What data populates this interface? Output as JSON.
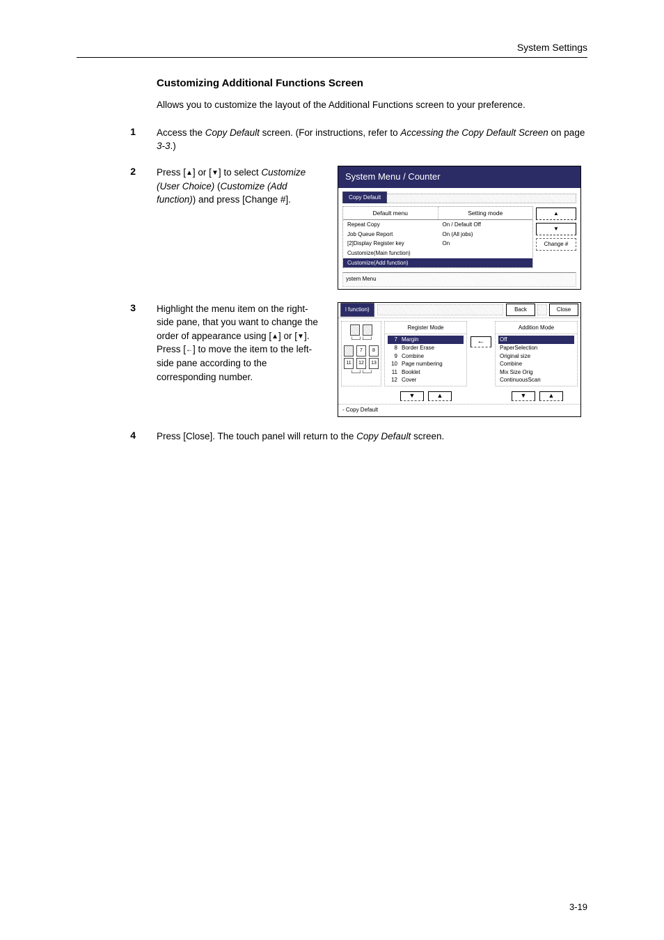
{
  "header": {
    "section": "System Settings"
  },
  "title": "Customizing Additional Functions Screen",
  "intro": "Allows you to customize the layout of the Additional Functions screen to your preference.",
  "steps": {
    "s1": {
      "num": "1",
      "a": "Access the ",
      "b": "Copy Default",
      "c": " screen. (For instructions, refer to ",
      "d": "Accessing the Copy Default Screen",
      "e": " on page ",
      "f": "3-3",
      "g": ".)"
    },
    "s2": {
      "num": "2",
      "a": "Press [",
      "b": "] or [",
      "c": "] to select ",
      "d": "Customize (User Choice)",
      "e": " (",
      "f": "Customize (Add function)",
      "g": ") and press [Change #]."
    },
    "s3": {
      "num": "3",
      "a": "Highlight the menu item on the right-side pane, that you want to change the order of appearance using [",
      "b": "] or [",
      "c": "]. Press [",
      "d": "] to move the item to the left-side pane according to the corresponding number."
    },
    "s4": {
      "num": "4",
      "a": "Press [Close]. The touch panel will return to the ",
      "b": "Copy Default",
      "c": " screen."
    }
  },
  "panel1": {
    "title": "System Menu / Counter",
    "tab": "Copy Default",
    "th1": "Default menu",
    "th2": "Setting mode",
    "rows": [
      {
        "c1": "Repeat Copy",
        "c2": "On / Default Off"
      },
      {
        "c1": "Job Queue Report",
        "c2": "On (All jobs)"
      },
      {
        "c1": "[2]Display Register key",
        "c2": "On"
      },
      {
        "c1": "Customize(Main function)",
        "c2": ""
      },
      {
        "c1": "Customize(Add function)",
        "c2": ""
      }
    ],
    "btn_change": "Change #",
    "footer": "ystem Menu"
  },
  "panel2": {
    "tab": "l function)",
    "back": "Back",
    "close": "Close",
    "reg_h": "Register Mode",
    "add_h": "Addition Mode",
    "reg_items": [
      {
        "n": "7",
        "t": "Margin"
      },
      {
        "n": "8",
        "t": "Border Erase"
      },
      {
        "n": "9",
        "t": "Combine"
      },
      {
        "n": "10",
        "t": "Page numbering"
      },
      {
        "n": "11",
        "t": "Booklet"
      },
      {
        "n": "12",
        "t": "Cover"
      }
    ],
    "add_items": [
      {
        "t": "Off"
      },
      {
        "t": "PaperSelection"
      },
      {
        "t": "Original size"
      },
      {
        "t": "Combine"
      },
      {
        "t": "Mix Size Orig"
      },
      {
        "t": "ContinuousScan"
      }
    ],
    "left_nums_bottom": [
      "11",
      "12",
      "13"
    ],
    "footer": "-   Copy Default"
  },
  "pagenum": "3-19"
}
